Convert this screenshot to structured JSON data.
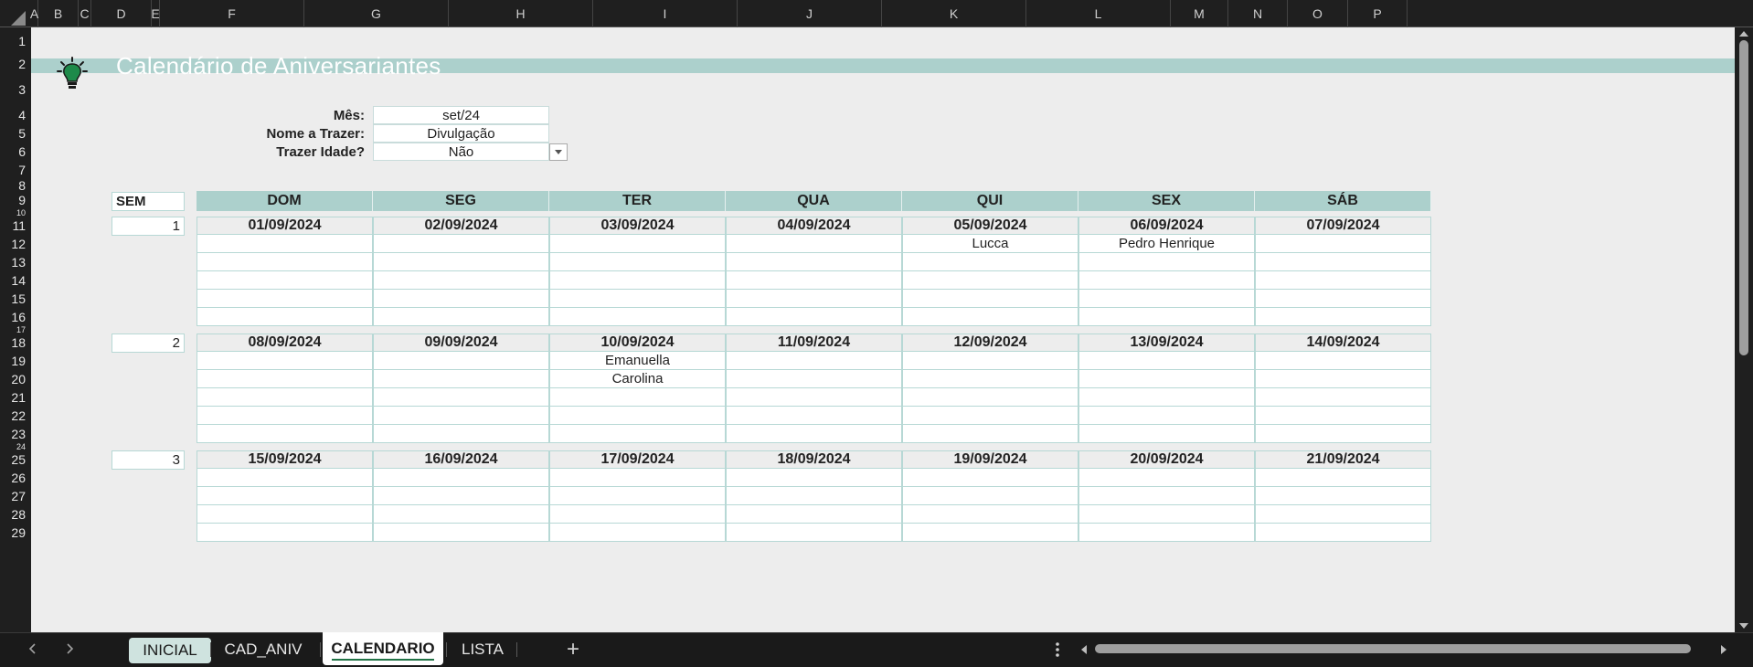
{
  "columns": [
    "A",
    "B",
    "C",
    "D",
    "E",
    "F",
    "G",
    "H",
    "I",
    "J",
    "K",
    "L",
    "M",
    "N",
    "O",
    "P"
  ],
  "rows": [
    "1",
    "2",
    "3",
    "4",
    "5",
    "6",
    "7",
    "8",
    "9",
    "10",
    "11",
    "12",
    "13",
    "14",
    "15",
    "16",
    "17",
    "18",
    "19",
    "20",
    "21",
    "22",
    "23",
    "24",
    "25",
    "26",
    "27",
    "28",
    "29"
  ],
  "title": "Calendário de Aniversariantes",
  "params": [
    {
      "label": "Mês:",
      "value": "set/24"
    },
    {
      "label": "Nome a Trazer:",
      "value": "Divulgação"
    },
    {
      "label": "Trazer Idade?",
      "value": "Não"
    }
  ],
  "sem_label": "SEM",
  "weekdays": [
    "DOM",
    "SEG",
    "TER",
    "QUA",
    "QUI",
    "SEX",
    "SÁB"
  ],
  "weeks": [
    {
      "number": "1",
      "dates": [
        "01/09/2024",
        "02/09/2024",
        "03/09/2024",
        "04/09/2024",
        "05/09/2024",
        "06/09/2024",
        "07/09/2024"
      ],
      "entries": [
        [
          "",
          "",
          "",
          "",
          "Lucca",
          "Pedro Henrique",
          ""
        ],
        [
          "",
          "",
          "",
          "",
          "",
          "",
          ""
        ],
        [
          "",
          "",
          "",
          "",
          "",
          "",
          ""
        ],
        [
          "",
          "",
          "",
          "",
          "",
          "",
          ""
        ],
        [
          "",
          "",
          "",
          "",
          "",
          "",
          ""
        ]
      ]
    },
    {
      "number": "2",
      "dates": [
        "08/09/2024",
        "09/09/2024",
        "10/09/2024",
        "11/09/2024",
        "12/09/2024",
        "13/09/2024",
        "14/09/2024"
      ],
      "entries": [
        [
          "",
          "",
          "Emanuella",
          "",
          "",
          "",
          ""
        ],
        [
          "",
          "",
          "Carolina",
          "",
          "",
          "",
          ""
        ],
        [
          "",
          "",
          "",
          "",
          "",
          "",
          ""
        ],
        [
          "",
          "",
          "",
          "",
          "",
          "",
          ""
        ],
        [
          "",
          "",
          "",
          "",
          "",
          "",
          ""
        ]
      ]
    },
    {
      "number": "3",
      "dates": [
        "15/09/2024",
        "16/09/2024",
        "17/09/2024",
        "18/09/2024",
        "19/09/2024",
        "20/09/2024",
        "21/09/2024"
      ],
      "entries": [
        [
          "",
          "",
          "",
          "",
          "",
          "",
          ""
        ],
        [
          "",
          "",
          "",
          "",
          "",
          "",
          ""
        ],
        [
          "",
          "",
          "",
          "",
          "",
          "",
          ""
        ],
        [
          "",
          "",
          "",
          "",
          "",
          "",
          ""
        ]
      ]
    }
  ],
  "tabs": [
    "INICIAL",
    "CAD_ANIV",
    "CALENDARIO",
    "LISTA"
  ],
  "active_tab": "CALENDARIO",
  "add_sheet_label": "+",
  "colors": {
    "accent": "#acd0cc",
    "tab_active_underline": "#217346",
    "grid": "#b7d8d5"
  },
  "icons": [
    "lightbulb-icon",
    "dropdown-arrow-icon",
    "scroll-left-icon",
    "scroll-right-icon",
    "more-options-icon",
    "add-sheet-icon",
    "scroll-up-icon",
    "scroll-down-icon"
  ]
}
